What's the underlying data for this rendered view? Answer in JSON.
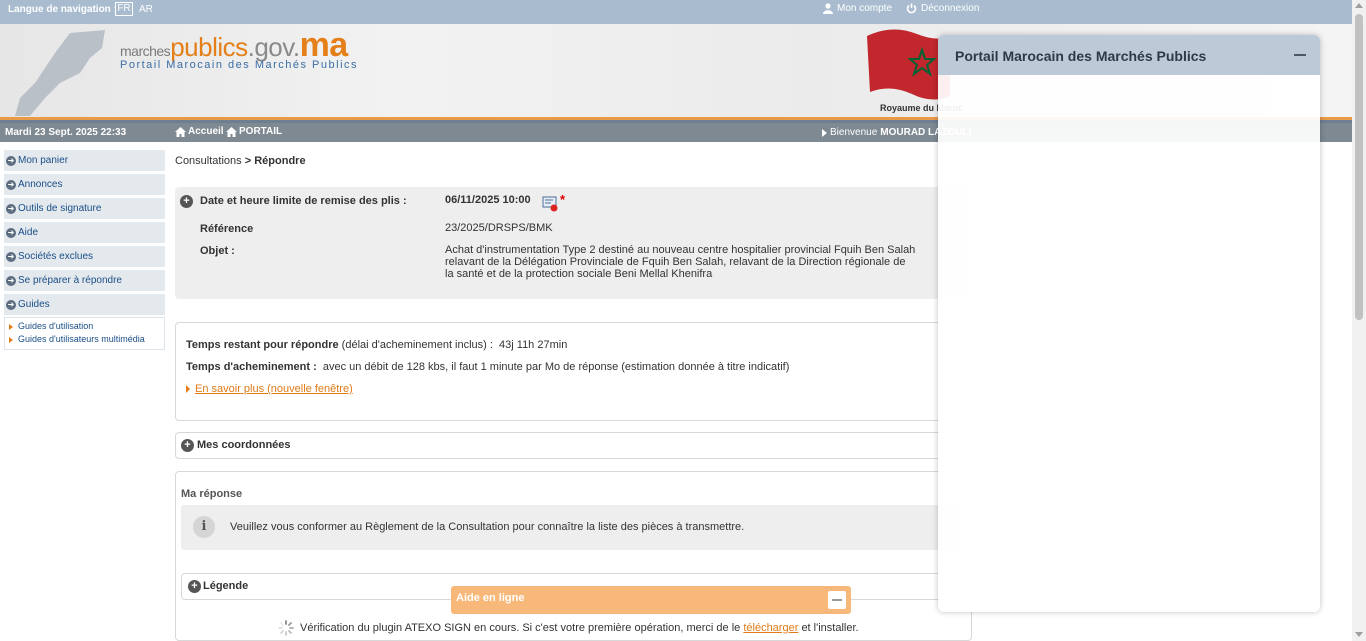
{
  "topbar": {
    "lang_label": "Langue de navigation :",
    "lang_fr": "FR",
    "lang_ar": "AR",
    "account": "Mon compte",
    "logout": "Déconnexion"
  },
  "banner": {
    "logo_marches": "marches",
    "logo_publics": "publics",
    "logo_gov": ".gov.",
    "logo_ma": "ma",
    "tagline": "Portail Marocain des Marchés Publics",
    "royaume": "Royaume du Maroc"
  },
  "navbar": {
    "date": "Mardi 23 Sept. 2025 22:33",
    "home": "Accueil",
    "portail": "PORTAIL",
    "welcome": "Bienvenue",
    "user": "MOURAD LAZOULI"
  },
  "sidebar": {
    "items": [
      {
        "label": "Mon panier"
      },
      {
        "label": "Annonces"
      },
      {
        "label": "Outils de signature"
      },
      {
        "label": "Aide"
      },
      {
        "label": "Sociétés exclues"
      },
      {
        "label": "Se préparer à répondre"
      },
      {
        "label": "Guides"
      }
    ],
    "guides": [
      "Guides d'utilisation",
      "Guides d'utilisateurs multimédia"
    ]
  },
  "breadcrumb": {
    "parent": "Consultations",
    "sep": ">",
    "current": "Répondre"
  },
  "consultation": {
    "deadline_label": "Date et heure limite de remise des plis :",
    "deadline_value": "06/11/2025 10:00",
    "asterisk": "*",
    "reference_label": "Référence",
    "reference_value": "23/2025/DRSPS/BMK",
    "objet_label": "Objet :",
    "objet_line1": "Achat d'instrumentation Type 2 destiné au nouveau centre hospitalier provincial Fquih Ben Salah",
    "objet_line2": "relavant de la Délégation Provinciale de Fquih Ben Salah, relavant de la Direction régionale de",
    "objet_line3": "la santé et de la protection sociale Beni Mellal Khenifra"
  },
  "timing": {
    "remaining_label": "Temps restant pour répondre",
    "remaining_note": "(délai d'acheminement inclus) :",
    "remaining_value": "43j 11h 27min",
    "transit_label": "Temps d'acheminement :",
    "transit_value": "avec un débit de 128 kbs, il faut 1 minute par Mo de réponse (estimation donnée à titre indicatif)",
    "learn_more": "En savoir plus (nouvelle fenêtre)"
  },
  "coordonnees": {
    "title": "Mes coordonnées"
  },
  "reponse": {
    "title": "Ma réponse",
    "info": "Veuillez vous conformer au Règlement de la Consultation pour connaître la liste des pièces à transmettre.",
    "legende": "Légende"
  },
  "aide": {
    "title": "Aide en ligne"
  },
  "plugin": {
    "text_before": "Vérification du plugin ATEXO SIGN en cours. Si c'est votre première opération, merci de le",
    "link": "télécharger",
    "text_after": "et l'installer."
  },
  "overlay": {
    "title": "Portail Marocain des Marchés Publics"
  },
  "colors": {
    "accent_orange": "#e57f19",
    "topbar": "#a9bccf",
    "navbar": "#7e8992"
  }
}
